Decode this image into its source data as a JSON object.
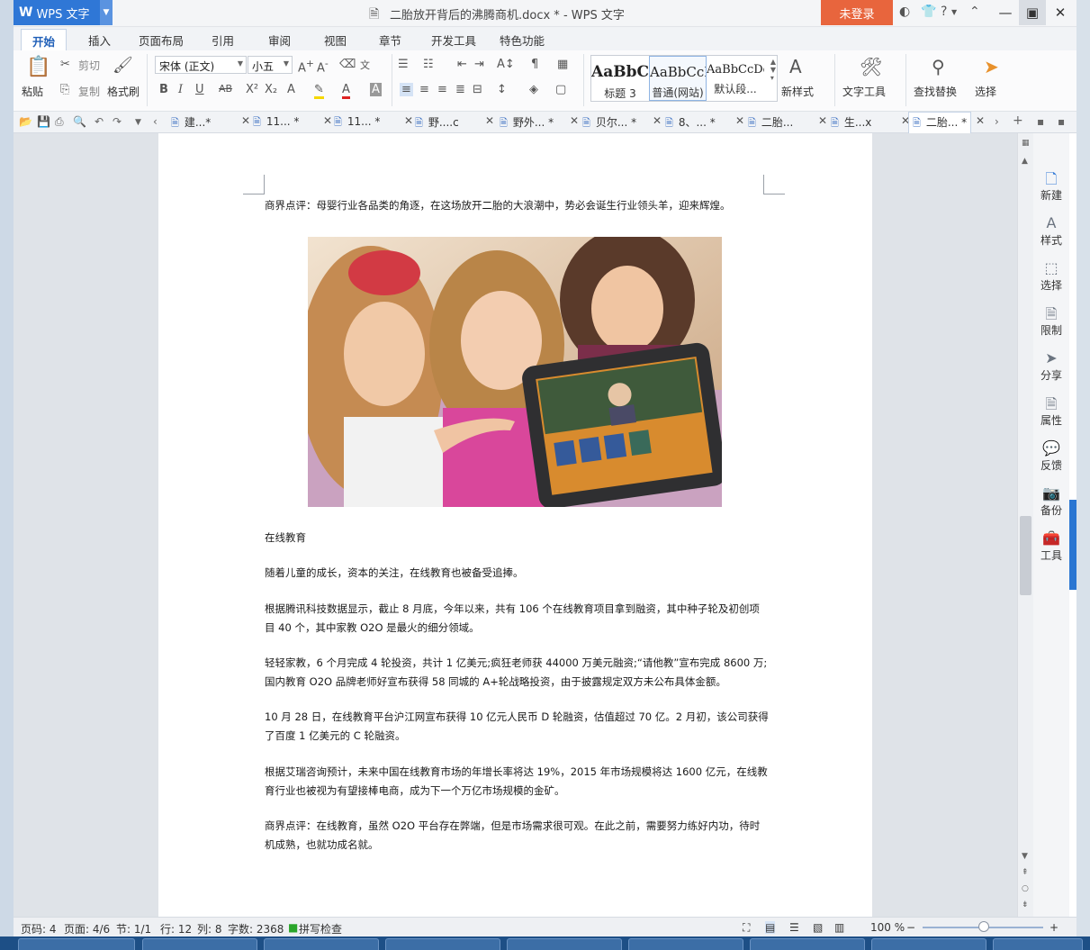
{
  "titlebar": {
    "app_name": "WPS 文字",
    "app_logo": "W",
    "document_title": "二胎放开背后的沸腾商机.docx * - WPS 文字",
    "login_label": "未登录",
    "help_label": "?"
  },
  "ribbon_tabs": [
    "开始",
    "插入",
    "页面布局",
    "引用",
    "审阅",
    "视图",
    "章节",
    "开发工具",
    "特色功能"
  ],
  "ribbon": {
    "paste": "粘贴",
    "cut": "剪切",
    "copy": "复制",
    "format_painter": "格式刷",
    "font_name": "宋体 (正文)",
    "font_size": "小五",
    "styles": [
      {
        "preview": "AaBbC",
        "name": "标题 3"
      },
      {
        "preview": "AaBbCcD",
        "name": "普通(网站)"
      },
      {
        "preview": "AaBbCcDd",
        "name": "默认段..."
      }
    ],
    "new_style": "新样式",
    "text_tools": "文字工具",
    "find_replace": "查找替换",
    "select": "选择"
  },
  "doc_tabs": [
    {
      "label": "建...*"
    },
    {
      "label": "11... *"
    },
    {
      "label": "11... *"
    },
    {
      "label": "野....c"
    },
    {
      "label": "野外... *"
    },
    {
      "label": "贝尔... *"
    },
    {
      "label": "8、... *"
    },
    {
      "label": "二胎..."
    },
    {
      "label": "生...x"
    },
    {
      "label": "二胎... *"
    }
  ],
  "document": {
    "paragraphs": [
      "商界点评：母婴行业各品类的角逐，在这场放开二胎的大浪潮中，势必会诞生行业领头羊，迎来辉煌。",
      "在线教育",
      "随着儿童的成长，资本的关注，在线教育也被备受追捧。",
      "根据腾讯科技数据显示，截止 8 月底，今年以来，共有 106 个在线教育项目拿到融资，其中种子轮及初创项目 40 个，其中家教 O2O 是最火的细分领域。",
      "轻轻家教，6 个月完成 4 轮投资，共计 1 亿美元;疯狂老师获 44000 万美元融资;“请他教”宣布完成 8600 万;国内教育 O2O 品牌老师好宣布获得 58 同城的 A+轮战略投资，由于披露规定双方未公布具体金额。",
      "10 月 28 日，在线教育平台沪江网宣布获得 10 亿元人民币 D 轮融资，估值超过 70 亿。2 月初，该公司获得了百度 1 亿美元的 C 轮融资。",
      "根据艾瑞咨询预计，未来中国在线教育市场的年增长率将达 19%，2015 年市场规模将达 1600 亿元，在线教育行业也被视为有望接棒电商，成为下一个万亿市场规模的金矿。",
      "商界点评：在线教育，虽然 O2O 平台存在弊端，但是市场需求很可观。在此之前，需要努力练好内功，待时机成熟，也就功成名就。"
    ]
  },
  "side_panel": [
    "新建",
    "样式",
    "选择",
    "限制",
    "分享",
    "属性",
    "反馈",
    "备份",
    "工具"
  ],
  "status": {
    "page_no": "页码: 4",
    "pages": "页面: 4/6",
    "section": "节: 1/1",
    "row": "行: 12",
    "col": "列: 8",
    "word_count": "字数: 2368",
    "spell_check": "拼写检查",
    "zoom": "100 %"
  },
  "colors": {
    "app_blue": "#2f77d6",
    "login_orange": "#e8653d",
    "page_background": "#dfe3e8",
    "side_strip": "#2a76d2"
  }
}
